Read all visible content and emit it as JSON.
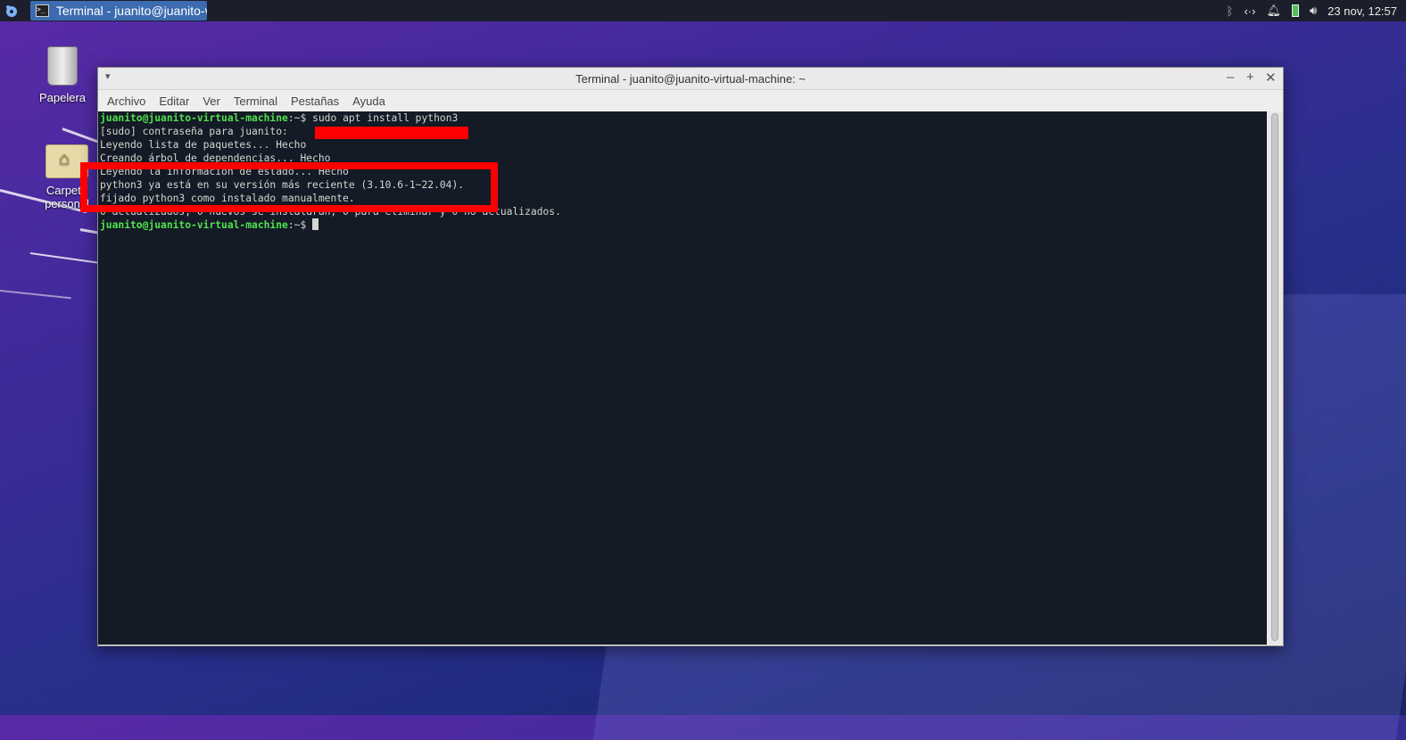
{
  "panel": {
    "task_label": "Terminal - juanito@juanito-v...",
    "clock": "23 nov, 12:57",
    "icons": [
      "bluetooth-icon",
      "network-icon",
      "bell-icon",
      "battery-icon",
      "volume-icon"
    ]
  },
  "desktop": {
    "trash_label": "Papelera",
    "home_label_line1": "Carpeta",
    "home_label_line2": "personal"
  },
  "window": {
    "title": "Terminal - juanito@juanito-virtual-machine: ~",
    "menu": [
      "Archivo",
      "Editar",
      "Ver",
      "Terminal",
      "Pestañas",
      "Ayuda"
    ]
  },
  "terminal": {
    "prompt_user": "juanito@juanito-virtual-machine",
    "prompt_path": ":~$ ",
    "command": "sudo apt install python3",
    "lines": [
      "[sudo] contraseña para juanito:",
      "Leyendo lista de paquetes... Hecho",
      "Creando árbol de dependencias... Hecho",
      "Leyendo la información de estado... Hecho",
      "python3 ya está en su versión más reciente (3.10.6-1~22.04).",
      "fijado python3 como instalado manualmente.",
      "0 actualizados, 0 nuevos se instalarán, 0 para eliminar y 0 no actualizados."
    ]
  },
  "colors": {
    "annotation": "#ff0000",
    "prompt": "#4ee44e",
    "terminal_bg": "#141a26"
  }
}
